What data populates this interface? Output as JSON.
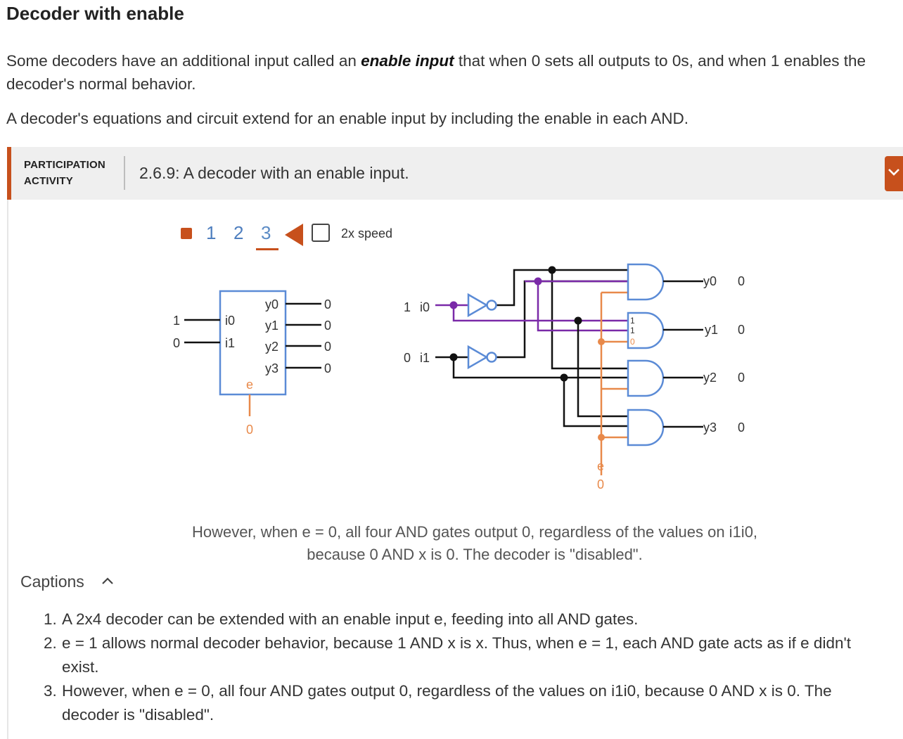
{
  "section": {
    "title": "Decoder with enable",
    "p1_before": "Some decoders have an additional input called an ",
    "p1_bold": "enable input",
    "p1_after": " that when 0 sets all outputs to 0s, and when 1 enables the decoder's normal behavior.",
    "p2": "A decoder's equations and circuit extend for an enable input by including the enable in each AND."
  },
  "activity": {
    "label_line1": "PARTICIPATION",
    "label_line2": "ACTIVITY",
    "title": "2.6.9: A decoder with an enable input.",
    "toggle_icon": "chevron-down-icon"
  },
  "controls": {
    "steps": [
      "1",
      "2",
      "3"
    ],
    "active_step": 3,
    "speed_label": "2x speed",
    "speed_checked": false
  },
  "block": {
    "inputs": [
      {
        "name": "i0",
        "value": "1"
      },
      {
        "name": "i1",
        "value": "0"
      }
    ],
    "outputs": [
      {
        "name": "y0",
        "value": "0"
      },
      {
        "name": "y1",
        "value": "0"
      },
      {
        "name": "y2",
        "value": "0"
      },
      {
        "name": "y3",
        "value": "0"
      }
    ],
    "enable_name": "e",
    "enable_value": "0"
  },
  "circuit": {
    "i0": {
      "value": "1",
      "name": "i0"
    },
    "i1": {
      "value": "0",
      "name": "i1"
    },
    "gate_inputs": [
      "1",
      "1",
      "0"
    ],
    "enable_name": "e",
    "enable_value": "0",
    "outputs": [
      {
        "name": "y0",
        "value": "0"
      },
      {
        "name": "y1",
        "value": "0"
      },
      {
        "name": "y2",
        "value": "0"
      },
      {
        "name": "y3",
        "value": "0"
      }
    ],
    "colors": {
      "wire": "#111111",
      "active": "#7a2aa8",
      "enable": "#e8894a",
      "gate": "#5b8bd6"
    }
  },
  "caption_current": "However, when e = 0, all four AND gates output 0, regardless of the values on i1i0, because 0 AND x is 0. The decoder is \"disabled\".",
  "captions": {
    "heading": "Captions",
    "toggle_icon": "chevron-up-icon",
    "items": [
      {
        "num": "1.",
        "text": "A 2x4 decoder can be extended with an enable input e, feeding into all AND gates."
      },
      {
        "num": "2.",
        "text": "e = 1 allows normal decoder behavior, because 1 AND x is x. Thus, when e = 1, each AND gate acts as if e didn't exist."
      },
      {
        "num": "3.",
        "text": "However, when e = 0, all four AND gates output 0, regardless of the values on i1i0, because 0 AND x is 0. The decoder is \"disabled\"."
      }
    ]
  }
}
